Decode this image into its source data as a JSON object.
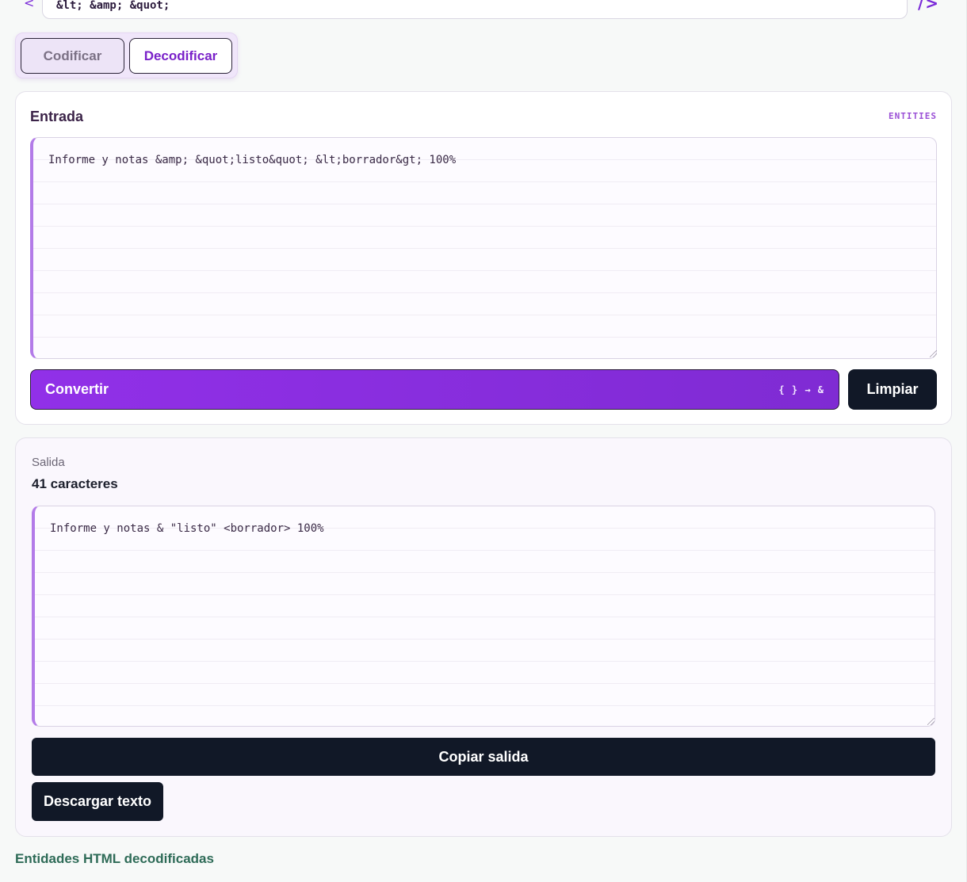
{
  "top": {
    "input_value": "&lt; &amp; &quot;",
    "left_arrow": "<",
    "right_glyph": "/>"
  },
  "mode": {
    "encode_label": "Codificar",
    "decode_label": "Decodificar",
    "selected": "Decodificar"
  },
  "input_card": {
    "title": "Entrada",
    "tag": "ENTITIES",
    "value": "Informe y notas &amp; &quot;listo&quot; &lt;borrador&gt; 100%",
    "convert_label": "Convertir",
    "convert_hint": "{ } → &",
    "clear_label": "Limpiar"
  },
  "output_card": {
    "label": "Salida",
    "count": "41 caracteres",
    "value": "Informe y notas & \"listo\" <borrador> 100%",
    "copy_label": "Copiar salida",
    "download_label": "Descargar texto"
  },
  "status": "Entidades HTML decodificadas",
  "colors": {
    "accent": "#7a22c9",
    "dark_button": "#111827",
    "status": "#2e6b57"
  }
}
